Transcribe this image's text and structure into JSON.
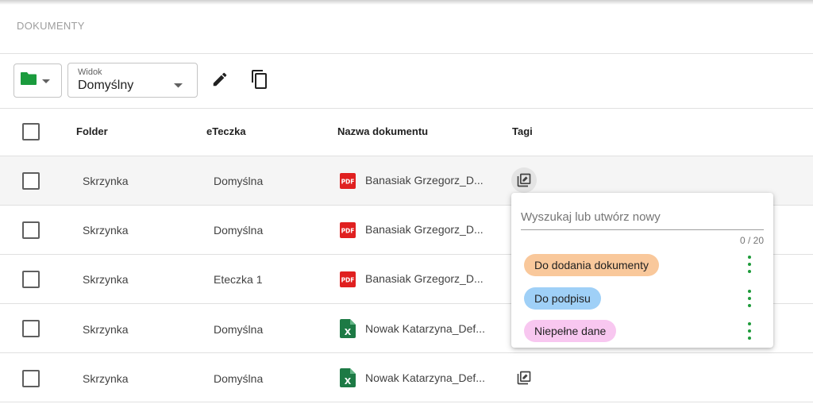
{
  "page": {
    "title": "DOKUMENTY"
  },
  "toolbar": {
    "folder_icon": "folder-icon",
    "folder_color": "#1a9b3d",
    "view": {
      "label": "Widok",
      "value": "Domyślny"
    },
    "edit_icon": "pencil-icon",
    "copy_icon": "copy-icon"
  },
  "table": {
    "columns": [
      "Folder",
      "eTeczka",
      "Nazwa dokumentu",
      "Tagi"
    ],
    "rows": [
      {
        "folder": "Skrzynka",
        "eteczka": "Domyślna",
        "name": "Banasiak Grzegorz_D...",
        "type": "pdf"
      },
      {
        "folder": "Skrzynka",
        "eteczka": "Domyślna",
        "name": "Banasiak Grzegorz_D...",
        "type": "pdf"
      },
      {
        "folder": "Skrzynka",
        "eteczka": "Eteczka 1",
        "name": "Banasiak Grzegorz_D...",
        "type": "pdf"
      },
      {
        "folder": "Skrzynka",
        "eteczka": "Domyślna",
        "name": "Nowak Katarzyna_Def...",
        "type": "xls"
      },
      {
        "folder": "Skrzynka",
        "eteczka": "Domyślna",
        "name": "Nowak Katarzyna_Def...",
        "type": "xls"
      }
    ]
  },
  "tag_popup": {
    "search_placeholder": "Wyszukaj lub utwórz nowy",
    "counter": "0 / 20",
    "tags": [
      {
        "label": "Do dodania dokumenty",
        "color": "#f9c89b"
      },
      {
        "label": "Do podpisu",
        "color": "#9fd0f7"
      },
      {
        "label": "Niepełne dane",
        "color": "#f8c7f0"
      }
    ]
  },
  "icons": {
    "pdf": "pdf-file-icon",
    "xls": "excel-file-icon",
    "tag": "tag-edit-icon",
    "more": "more-vert-icon"
  },
  "colors": {
    "pdf": "#e02020",
    "xls": "#1d7a45",
    "accent": "#1e9b3a"
  }
}
